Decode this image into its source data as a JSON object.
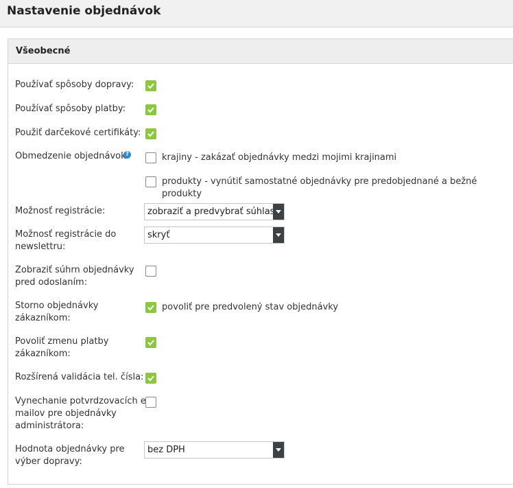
{
  "header": {
    "title": "Nastavenie objednávok"
  },
  "section": {
    "title": "Všeobecné"
  },
  "fields": {
    "shipping": {
      "label": "Používať spôsoby dopravy:",
      "checked": true
    },
    "payment": {
      "label": "Používať spôsoby platby:",
      "checked": true
    },
    "gift": {
      "label": "Použiť darčekové certifikáty:",
      "checked": true
    },
    "restriction": {
      "label": "Obmedzenie objednávok:",
      "help_icon": "question-icon",
      "options": [
        {
          "label": "krajiny - zakázať objednávky medzi mojimi krajinami",
          "checked": false
        },
        {
          "label": "produkty - vynútiť samostatné objednávky pre predobjednané a bežné produkty",
          "checked": false
        }
      ]
    },
    "registration": {
      "label": "Možnosť registrácie:",
      "value": "zobraziť a predvybrať súhlas"
    },
    "newsletter": {
      "label_line1": "Možnosť registrácie do",
      "label_line2": "newslettru:",
      "value": "skryť"
    },
    "summary": {
      "label_line1": "Zobraziť súhrn objednávky",
      "label_line2": "pred odoslaním:",
      "checked": false
    },
    "storno": {
      "label_line1": "Storno objednávky",
      "label_line2": "zákazníkom:",
      "option": "povoliť pre predvolený stav objednávky",
      "checked": true
    },
    "payment_change": {
      "label_line1": "Povoliť zmenu platby",
      "label_line2": "zákazníkom:",
      "checked": true
    },
    "phone_validation": {
      "label": "Rozšírená validácia tel. čísla:",
      "checked": true
    },
    "skip_emails": {
      "label_line1": "Vynechanie potvrdzovacích e-",
      "label_line2": "mailov pre objednávky",
      "label_line3": "administrátora:",
      "checked": false
    },
    "order_value": {
      "label_line1": "Hodnota objednávky pre",
      "label_line2": "výber dopravy:",
      "value": "bez DPH"
    }
  },
  "colors": {
    "checkbox_on": "#8dc63f",
    "select_arrow_bg": "#3c4146",
    "help_icon": "#2a8ad4"
  }
}
